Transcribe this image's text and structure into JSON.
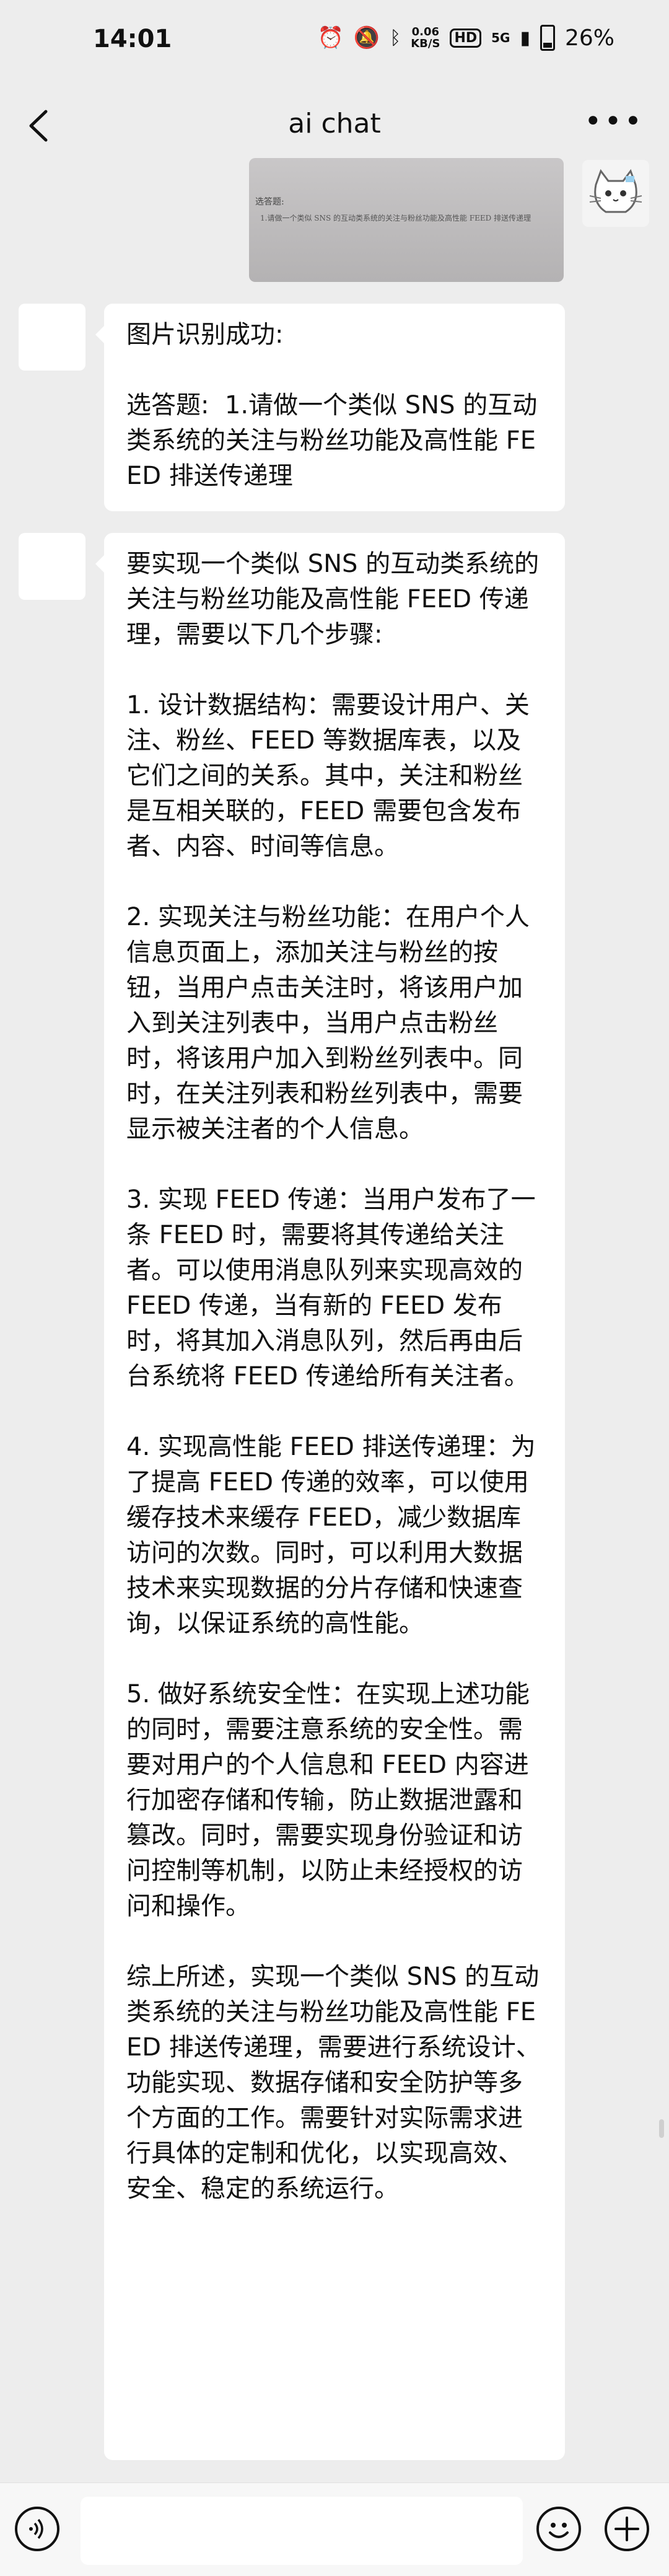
{
  "status_bar": {
    "time": "14:01",
    "net_speed_value": "0.06",
    "net_speed_unit": "KB/S",
    "hd_label": "HD",
    "signal_label": "5G",
    "battery_percent": "26%"
  },
  "header": {
    "title": "ai chat"
  },
  "image_message": {
    "line1": "选答题:",
    "line2": "1.请做一个类似 SNS 的互动类系统的关注与粉丝功能及高性能 FEED 排送传递理"
  },
  "messages": [
    {
      "text": "图片识别成功:\n\n选答题:  1.请做一个类似 SNS 的互动类系统的关注与粉丝功能及高性能 FEED 排送传递理"
    },
    {
      "text": "要实现一个类似 SNS 的互动类系统的关注与粉丝功能及高性能 FEED 传递理，需要以下几个步骤:\n\n1. 设计数据结构：需要设计用户、关注、粉丝、FEED 等数据库表，以及它们之间的关系。其中，关注和粉丝是互相关联的，FEED 需要包含发布者、内容、时间等信息。\n\n2. 实现关注与粉丝功能：在用户个人信息页面上，添加关注与粉丝的按钮，当用户点击关注时，将该用户加入到关注列表中，当用户点击粉丝时，将该用户加入到粉丝列表中。同时，在关注列表和粉丝列表中，需要显示被关注者的个人信息。\n\n3. 实现 FEED 传递：当用户发布了一条 FEED 时，需要将其传递给关注者。可以使用消息队列来实现高效的 FEED 传递，当有新的 FEED 发布时，将其加入消息队列，然后再由后台系统将 FEED 传递给所有关注者。\n\n4. 实现高性能 FEED 排送传递理：为了提高 FEED 传递的效率，可以使用缓存技术来缓存 FEED，减少数据库访问的次数。同时，可以利用大数据技术来实现数据的分片存储和快速查询，以保证系统的高性能。\n\n5. 做好系统安全性：在实现上述功能的同时，需要注意系统的安全性。需要对用户的个人信息和 FEED 内容进行加密存储和传输，防止数据泄露和篡改。同时，需要实现身份验证和访问控制等机制，以防止未经授权的访问和操作。\n\n综上所述，实现一个类似 SNS 的互动类系统的关注与粉丝功能及高性能 FEED 排送传递理，需要进行系统设计、功能实现、数据存储和安全防护等多个方面的工作。需要针对实际需求进行具体的定制和优化，以实现高效、安全、稳定的系统运行。"
    }
  ],
  "input_bar": {
    "placeholder": ""
  },
  "colors": {
    "background": "#ededed",
    "bubble": "#ffffff",
    "input_bar": "#f7f7f7"
  }
}
